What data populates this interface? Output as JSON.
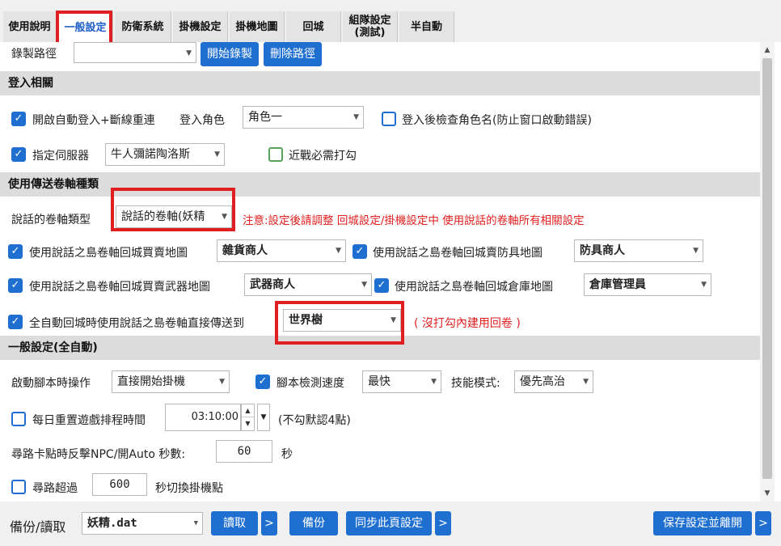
{
  "tabs": [
    {
      "label": "使用說明"
    },
    {
      "label": "一般設定"
    },
    {
      "label": "防衛系統"
    },
    {
      "label": "掛機設定"
    },
    {
      "label": "掛機地圖"
    },
    {
      "label": "回城"
    },
    {
      "label": "組隊設定\n(測試)"
    },
    {
      "label": "半自動"
    }
  ],
  "route": {
    "label": "錄製路徑",
    "value": "",
    "start_button": "開始錄製",
    "delete_button": "刪除路徑"
  },
  "login": {
    "section_title": "登入相關",
    "auto_login": {
      "checked": true,
      "label": "開啟自動登入+斷線重連"
    },
    "login_role_label": "登入角色",
    "login_role_value": "角色一",
    "check_role_name": {
      "checked": false,
      "label": "登入後檢查角色名(防止窗口啟動錯誤)"
    },
    "specify_server": {
      "checked": true,
      "label": "指定伺服器"
    },
    "server_value": "牛人彌諾陶洛斯",
    "melee_required": {
      "checked": false,
      "label": "近戰必需打勾"
    }
  },
  "scroll": {
    "section_title": "使用傳送卷軸種類",
    "type_label": "說話的卷軸類型",
    "type_value": "說話的卷軸(妖精",
    "note": "注意:設定後請調整 回城設定/掛機設定中 使用說話的卷軸所有相關設定",
    "row1_left": {
      "checked": true,
      "label": "使用說話之島卷軸回城買賣地圖",
      "value": "雜貨商人"
    },
    "row1_right": {
      "checked": true,
      "label": "使用說話之島卷軸回城賣防具地圖",
      "value": "防具商人"
    },
    "row2_left": {
      "checked": true,
      "label": "使用說話之島卷軸回城買賣武器地圖",
      "value": "武器商人"
    },
    "row2_right": {
      "checked": true,
      "label": "使用說話之島卷軸回城倉庫地圖",
      "value": "倉庫管理員"
    },
    "auto_return": {
      "checked": true,
      "label": "全自動回城時使用說話之島卷軸直接傳送到",
      "value": "世界樹"
    },
    "auto_return_note": "( 沒打勾內建用回卷 )"
  },
  "general": {
    "section_title": "一般設定(全自動)",
    "startup_label": "啟動腳本時操作",
    "startup_value": "直接開始掛機",
    "detect_speed": {
      "checked": true,
      "label": "腳本檢測速度",
      "value": "最快"
    },
    "skill_mode_label": "技能模式:",
    "skill_mode_value": "優先高治",
    "daily_reset": {
      "checked": false,
      "label": "每日重置遊戲排程時間",
      "value": "03:10:00",
      "note": "(不勾默認4點)"
    },
    "stuck_label": "尋路卡點時反擊NPC/開Auto 秒數:",
    "stuck_value": "60",
    "stuck_unit": "秒",
    "path_timeout": {
      "checked": false,
      "label": "尋路超過",
      "value": "600",
      "suffix": "秒切換掛機點"
    }
  },
  "footer": {
    "backup_label": "備份/讀取",
    "file_value": "妖精.dat",
    "read_button": "讀取",
    "more": ">",
    "backup_button": "備份",
    "sync_button": "同步此頁設定",
    "save_exit_button": "保存設定並離開"
  },
  "colors": {
    "accent": "#1f6fd1",
    "highlight_box": "#e02020",
    "note_text": "#e02020",
    "section_bg": "#dcdcdc"
  }
}
